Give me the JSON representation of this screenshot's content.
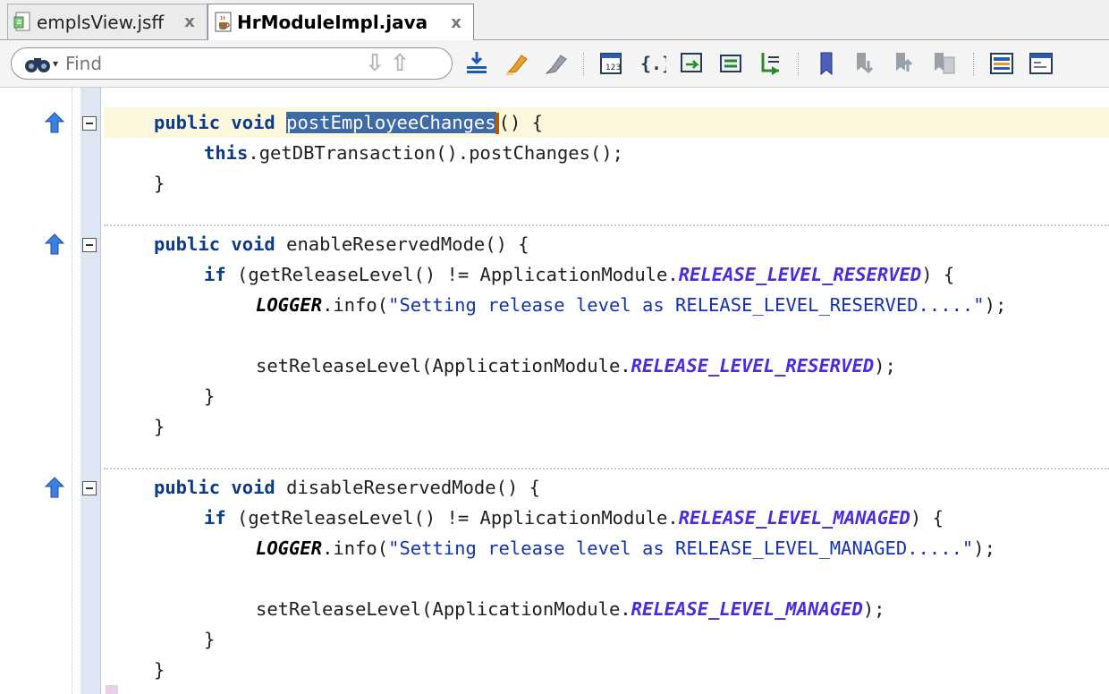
{
  "tabs": [
    {
      "label": "emplsView.jsff",
      "icon": "jsff-file-icon",
      "active": false
    },
    {
      "label": "HrModuleImpl.java",
      "icon": "java-file-icon",
      "active": true
    }
  ],
  "tab_close_glyph": "x",
  "toolbar": {
    "find_placeholder": "Find",
    "icons": [
      "import-icon",
      "highlight-icon",
      "clear-highlight-icon",
      "surround-with-icon",
      "braces-icon",
      "override-methods-icon",
      "generate-accessors-icon",
      "implement-interface-icon",
      "toggle-bookmark-icon",
      "previous-bookmark-icon",
      "next-bookmark-icon",
      "bookmarks-list-icon",
      "toggle-block-icon",
      "code-template-icon"
    ]
  },
  "code": {
    "method1": {
      "sig_kw": "public void ",
      "name": "postEmployeeChanges",
      "sig_rest": "() {",
      "body_kw": "this",
      "body_rest": ".getDBTransaction().postChanges();",
      "close": "}"
    },
    "method2": {
      "sig_kw": "public void ",
      "sig_rest": "enableReservedMode() {",
      "if_kw": "if",
      "if_mid": " (getReleaseLevel() != ApplicationModule.",
      "if_const": "RELEASE_LEVEL_RESERVED",
      "if_end": ") {",
      "logger": "LOGGER",
      "log_mid": ".info(",
      "log_str": "\"Setting release level as RELEASE_LEVEL_RESERVED.....\"",
      "log_end": ");",
      "set_pre": "setReleaseLevel(ApplicationModule.",
      "set_const": "RELEASE_LEVEL_RESERVED",
      "set_end": ");",
      "close_inner": "}",
      "close": "}"
    },
    "method3": {
      "sig_kw": "public void ",
      "sig_rest": "disableReservedMode() {",
      "if_kw": "if",
      "if_mid": " (getReleaseLevel() != ApplicationModule.",
      "if_const": "RELEASE_LEVEL_MANAGED",
      "if_end": ") {",
      "logger": "LOGGER",
      "log_mid": ".info(",
      "log_str": "\"Setting release level as RELEASE_LEVEL_MANAGED.....\"",
      "log_end": ");",
      "set_pre": "setReleaseLevel(ApplicationModule.",
      "set_const": "RELEASE_LEVEL_MANAGED",
      "set_end": ");",
      "close_inner": "}",
      "close": "}"
    }
  },
  "colors": {
    "keyword": "#0d3a8a",
    "string": "#1531b5",
    "constant": "#4a2be0",
    "selection": "#3e6aa8",
    "current_line": "#fbf8de",
    "gutter": "#dde6f2"
  }
}
